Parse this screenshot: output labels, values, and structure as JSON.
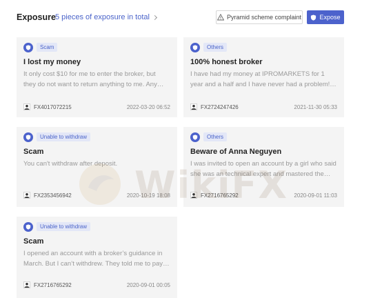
{
  "header": {
    "title": "Exposure",
    "count_text": "5 pieces of exposure in total",
    "complaint_label": "Pyramid scheme complaint",
    "expose_label": "Expose"
  },
  "cards": [
    {
      "tag": "Scam",
      "title": "I lost my money",
      "body": "It only cost $10 for me to enter the broker, but they do not want to return anything to me. Any advice?",
      "user": "FX4017072215",
      "date": "2022-03-20 06:52"
    },
    {
      "tag": "Others",
      "title": "100% honest broker",
      "body": "I have had my money at IPROMARKETS for 1 year and a half and I have never had a problem! It's a great broker.",
      "user": "FX2724247426",
      "date": "2021-11-30 05:33"
    },
    {
      "tag": "Unable to withdraw",
      "title": "Scam",
      "body": "You can't withdraw after deposit.",
      "user": "FX2353456942",
      "date": "2020-10-19 18:08"
    },
    {
      "tag": "Others",
      "title": "Beware of Anna Neguyen",
      "body": "I was invited to open an account by a girl who said she was an technical expert and mastered the market.",
      "user": "FX2716765292",
      "date": "2020-09-01 11:03"
    },
    {
      "tag": "Unable to withdraw",
      "title": "Scam",
      "body": "I opened an account with a broker’s guidance in March. But I can’t withdrew. They told me to pay more fees.",
      "user": "FX2716765292",
      "date": "2020-09-01 00:05"
    }
  ],
  "watermark": {
    "text": "WikiFX"
  },
  "colors": {
    "accent": "#4c62cc",
    "tag_bg": "#e3e7f7",
    "card_bg": "#f4f4f4"
  }
}
